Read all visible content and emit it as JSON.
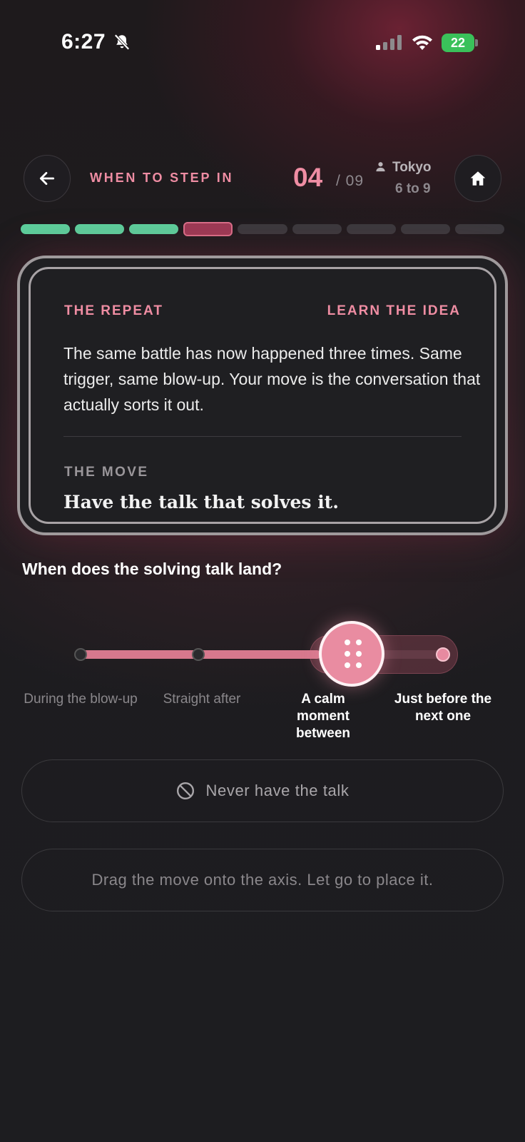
{
  "status_bar": {
    "time": "6:27",
    "battery": "22",
    "icons": [
      "bell-slash-icon",
      "signal-icon",
      "wifi-icon",
      "battery-charging-icon"
    ]
  },
  "header": {
    "back_icon": "arrow-left-icon",
    "title": "WHEN TO STEP IN",
    "step_current": "04",
    "step_total": "/ 09",
    "person_icon": "person-icon",
    "city": "Tokyo",
    "time_range": "6 to 9",
    "home_icon": "home-icon"
  },
  "progress": {
    "total": 9,
    "completed": 3,
    "current": 4,
    "colors": {
      "done": "#5ccf9c",
      "current": "#9c3a55",
      "todo": "#3a393d"
    }
  },
  "card": {
    "label": "THE REPEAT",
    "link": "LEARN THE IDEA",
    "body": "The same battle has now happened three times. Same trigger, same blow-up. Your move is the conversation that actually sorts it out.",
    "move_label": "THE MOVE",
    "move_text": "Have the talk that solves it."
  },
  "question": "When does the solving talk land?",
  "axis": {
    "options": [
      "During the blow-up",
      "Straight after",
      "A calm moment between",
      "Just before the next one"
    ],
    "selected_index": 2,
    "accent": "#e98ca1"
  },
  "never_button": {
    "icon": "ban-icon",
    "label": "Never have the talk"
  },
  "hint": "Drag the move onto the axis. Let go to place it."
}
